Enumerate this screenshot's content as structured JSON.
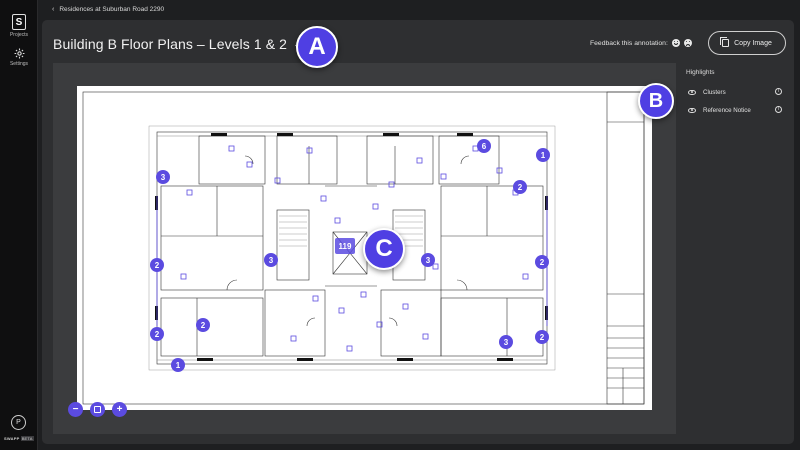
{
  "rail": {
    "projects_label": "Projects",
    "settings_label": "Settings",
    "logo_letter": "S",
    "avatar_letter": "P",
    "brand_name": "SWAPP",
    "brand_tag": "BETA"
  },
  "breadcrumb": {
    "text": "Residences at Suburban Road 2290"
  },
  "header": {
    "title": "Building B Floor Plans – Levels 1 & 2",
    "feedback_label": "Feedback this annotation:",
    "copy_button_label": "Copy Image"
  },
  "highlights": {
    "title": "Highlights",
    "items": [
      {
        "label": "Clusters"
      },
      {
        "label": "Reference Notice"
      }
    ]
  },
  "zoom": {
    "minus": "−",
    "plus": "+"
  },
  "callouts": {
    "a": "A",
    "b": "B",
    "c": "C"
  },
  "clusters": [
    "1",
    "3",
    "6",
    "2",
    "2",
    "2",
    "3",
    "3",
    "2",
    "2",
    "2",
    "2",
    "3",
    "2",
    "1",
    "119"
  ],
  "colors": {
    "accent": "#5b4be0",
    "panel": "#2e2f31",
    "background": "#1e1f21"
  }
}
